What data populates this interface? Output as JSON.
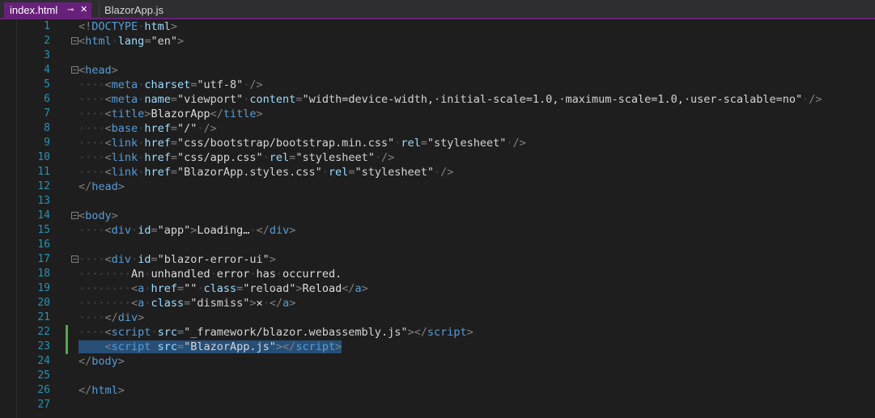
{
  "tabs": [
    {
      "label": "index.html",
      "active": true,
      "pin_icon": "pin-icon",
      "close_icon": "close-icon"
    },
    {
      "label": "BlazorApp.js",
      "active": false
    }
  ],
  "colors": {
    "accent": "#68217a",
    "tag": "#569cd6",
    "attribute": "#9cdcfe",
    "bracket": "#808080",
    "text": "#dcdcdc",
    "line_number": "#2b91af",
    "change_marker": "#57a64a",
    "selection": "#264f78"
  },
  "lines": [
    {
      "n": "1",
      "tokens": [
        [
          "b",
          "<!"
        ],
        [
          "t",
          "DOCTYPE"
        ],
        [
          "g",
          "·"
        ],
        [
          "a",
          "html"
        ],
        [
          "b",
          ">"
        ]
      ]
    },
    {
      "n": "2",
      "fold": true,
      "tokens": [
        [
          "b",
          "<"
        ],
        [
          "t",
          "html"
        ],
        [
          "g",
          "·"
        ],
        [
          "a",
          "lang"
        ],
        [
          "b",
          "="
        ],
        [
          "v",
          "\"en\""
        ],
        [
          "b",
          ">"
        ]
      ]
    },
    {
      "n": "3",
      "tokens": []
    },
    {
      "n": "4",
      "fold": true,
      "tokens": [
        [
          "b",
          "<"
        ],
        [
          "t",
          "head"
        ],
        [
          "b",
          ">"
        ]
      ]
    },
    {
      "n": "5",
      "tokens": [
        [
          "g",
          "····"
        ],
        [
          "b",
          "<"
        ],
        [
          "t",
          "meta"
        ],
        [
          "g",
          "·"
        ],
        [
          "a",
          "charset"
        ],
        [
          "b",
          "="
        ],
        [
          "v",
          "\"utf-8\""
        ],
        [
          "g",
          "·"
        ],
        [
          "b",
          "/>"
        ]
      ]
    },
    {
      "n": "6",
      "tokens": [
        [
          "g",
          "····"
        ],
        [
          "b",
          "<"
        ],
        [
          "t",
          "meta"
        ],
        [
          "g",
          "·"
        ],
        [
          "a",
          "name"
        ],
        [
          "b",
          "="
        ],
        [
          "v",
          "\"viewport\""
        ],
        [
          "g",
          "·"
        ],
        [
          "a",
          "content"
        ],
        [
          "b",
          "="
        ],
        [
          "v",
          "\"width=device-width,·initial-scale=1.0,·maximum-scale=1.0,·user-scalable=no\""
        ],
        [
          "g",
          "·"
        ],
        [
          "b",
          "/>"
        ]
      ]
    },
    {
      "n": "7",
      "tokens": [
        [
          "g",
          "····"
        ],
        [
          "b",
          "<"
        ],
        [
          "t",
          "title"
        ],
        [
          "b",
          ">"
        ],
        [
          "x",
          "BlazorApp"
        ],
        [
          "b",
          "</"
        ],
        [
          "t",
          "title"
        ],
        [
          "b",
          ">"
        ]
      ]
    },
    {
      "n": "8",
      "tokens": [
        [
          "g",
          "····"
        ],
        [
          "b",
          "<"
        ],
        [
          "t",
          "base"
        ],
        [
          "g",
          "·"
        ],
        [
          "a",
          "href"
        ],
        [
          "b",
          "="
        ],
        [
          "v",
          "\"/\""
        ],
        [
          "g",
          "·"
        ],
        [
          "b",
          "/>"
        ]
      ]
    },
    {
      "n": "9",
      "tokens": [
        [
          "g",
          "····"
        ],
        [
          "b",
          "<"
        ],
        [
          "t",
          "link"
        ],
        [
          "g",
          "·"
        ],
        [
          "a",
          "href"
        ],
        [
          "b",
          "="
        ],
        [
          "v",
          "\"css/bootstrap/bootstrap.min.css\""
        ],
        [
          "g",
          "·"
        ],
        [
          "a",
          "rel"
        ],
        [
          "b",
          "="
        ],
        [
          "v",
          "\"stylesheet\""
        ],
        [
          "g",
          "·"
        ],
        [
          "b",
          "/>"
        ]
      ]
    },
    {
      "n": "10",
      "tokens": [
        [
          "g",
          "····"
        ],
        [
          "b",
          "<"
        ],
        [
          "t",
          "link"
        ],
        [
          "g",
          "·"
        ],
        [
          "a",
          "href"
        ],
        [
          "b",
          "="
        ],
        [
          "v",
          "\"css/app.css\""
        ],
        [
          "g",
          "·"
        ],
        [
          "a",
          "rel"
        ],
        [
          "b",
          "="
        ],
        [
          "v",
          "\"stylesheet\""
        ],
        [
          "g",
          "·"
        ],
        [
          "b",
          "/>"
        ]
      ]
    },
    {
      "n": "11",
      "tokens": [
        [
          "g",
          "····"
        ],
        [
          "b",
          "<"
        ],
        [
          "t",
          "link"
        ],
        [
          "g",
          "·"
        ],
        [
          "a",
          "href"
        ],
        [
          "b",
          "="
        ],
        [
          "v",
          "\"BlazorApp.styles.css\""
        ],
        [
          "g",
          "·"
        ],
        [
          "a",
          "rel"
        ],
        [
          "b",
          "="
        ],
        [
          "v",
          "\"stylesheet\""
        ],
        [
          "g",
          "·"
        ],
        [
          "b",
          "/>"
        ]
      ]
    },
    {
      "n": "12",
      "tokens": [
        [
          "b",
          "</"
        ],
        [
          "t",
          "head"
        ],
        [
          "b",
          ">"
        ]
      ]
    },
    {
      "n": "13",
      "tokens": []
    },
    {
      "n": "14",
      "fold": true,
      "tokens": [
        [
          "b",
          "<"
        ],
        [
          "t",
          "body"
        ],
        [
          "b",
          ">"
        ]
      ]
    },
    {
      "n": "15",
      "tokens": [
        [
          "g",
          "····"
        ],
        [
          "b",
          "<"
        ],
        [
          "t",
          "div"
        ],
        [
          "g",
          "·"
        ],
        [
          "a",
          "id"
        ],
        [
          "b",
          "="
        ],
        [
          "v",
          "\"app\""
        ],
        [
          "b",
          ">"
        ],
        [
          "x",
          "Loading…"
        ],
        [
          "g",
          "·"
        ],
        [
          "b",
          "</"
        ],
        [
          "t",
          "div"
        ],
        [
          "b",
          ">"
        ]
      ]
    },
    {
      "n": "16",
      "tokens": []
    },
    {
      "n": "17",
      "fold": true,
      "tokens": [
        [
          "g",
          "····"
        ],
        [
          "b",
          "<"
        ],
        [
          "t",
          "div"
        ],
        [
          "g",
          "·"
        ],
        [
          "a",
          "id"
        ],
        [
          "b",
          "="
        ],
        [
          "v",
          "\"blazor-error-ui\""
        ],
        [
          "b",
          ">"
        ]
      ]
    },
    {
      "n": "18",
      "tokens": [
        [
          "g",
          "········"
        ],
        [
          "x",
          "An"
        ],
        [
          "g",
          "·"
        ],
        [
          "x",
          "unhandled"
        ],
        [
          "g",
          "·"
        ],
        [
          "x",
          "error"
        ],
        [
          "g",
          "·"
        ],
        [
          "x",
          "has"
        ],
        [
          "g",
          "·"
        ],
        [
          "x",
          "occurred."
        ]
      ]
    },
    {
      "n": "19",
      "tokens": [
        [
          "g",
          "········"
        ],
        [
          "b",
          "<"
        ],
        [
          "t",
          "a"
        ],
        [
          "g",
          "·"
        ],
        [
          "a",
          "href"
        ],
        [
          "b",
          "="
        ],
        [
          "v",
          "\"\""
        ],
        [
          "g",
          "·"
        ],
        [
          "a",
          "class"
        ],
        [
          "b",
          "="
        ],
        [
          "v",
          "\"reload\""
        ],
        [
          "b",
          ">"
        ],
        [
          "x",
          "Reload"
        ],
        [
          "b",
          "</"
        ],
        [
          "t",
          "a"
        ],
        [
          "b",
          ">"
        ]
      ]
    },
    {
      "n": "20",
      "tokens": [
        [
          "g",
          "········"
        ],
        [
          "b",
          "<"
        ],
        [
          "t",
          "a"
        ],
        [
          "g",
          "·"
        ],
        [
          "a",
          "class"
        ],
        [
          "b",
          "="
        ],
        [
          "v",
          "\"dismiss\""
        ],
        [
          "b",
          ">"
        ],
        [
          "x",
          "✕"
        ],
        [
          "g",
          "·"
        ],
        [
          "b",
          "</"
        ],
        [
          "t",
          "a"
        ],
        [
          "b",
          ">"
        ]
      ]
    },
    {
      "n": "21",
      "tokens": [
        [
          "g",
          "····"
        ],
        [
          "b",
          "</"
        ],
        [
          "t",
          "div"
        ],
        [
          "b",
          ">"
        ]
      ]
    },
    {
      "n": "22",
      "change": true,
      "tokens": [
        [
          "g",
          "····"
        ],
        [
          "b",
          "<"
        ],
        [
          "t",
          "script"
        ],
        [
          "g",
          "·"
        ],
        [
          "a",
          "src"
        ],
        [
          "b",
          "="
        ],
        [
          "v",
          "\"_framework/blazor.webassembly.js\""
        ],
        [
          "b",
          ">"
        ],
        [
          "b",
          "</"
        ],
        [
          "t",
          "script"
        ],
        [
          "b",
          ">"
        ]
      ]
    },
    {
      "n": "23",
      "change": true,
      "selected": true,
      "tokens": [
        [
          "g",
          "····"
        ],
        [
          "b",
          "<"
        ],
        [
          "t",
          "script"
        ],
        [
          "g",
          "·"
        ],
        [
          "a",
          "src"
        ],
        [
          "b",
          "="
        ],
        [
          "v",
          "\"BlazorApp.js\""
        ],
        [
          "b",
          ">"
        ],
        [
          "b",
          "</"
        ],
        [
          "t",
          "script"
        ],
        [
          "b",
          ">"
        ]
      ]
    },
    {
      "n": "24",
      "tokens": [
        [
          "b",
          "</"
        ],
        [
          "t",
          "body"
        ],
        [
          "b",
          ">"
        ]
      ]
    },
    {
      "n": "25",
      "tokens": []
    },
    {
      "n": "26",
      "tokens": [
        [
          "b",
          "</"
        ],
        [
          "t",
          "html"
        ],
        [
          "b",
          ">"
        ]
      ]
    },
    {
      "n": "27",
      "tokens": []
    }
  ]
}
